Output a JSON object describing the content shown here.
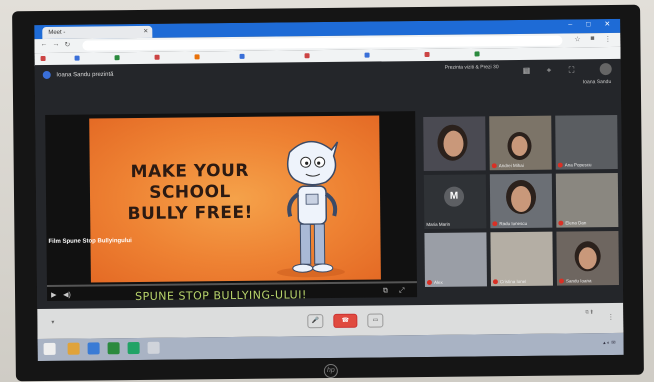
{
  "browser": {
    "tab_title": "Meet - ",
    "window_controls": "– □ ✕",
    "bookmarks": [
      "",
      "",
      "",
      "",
      "",
      "",
      "",
      "",
      "",
      ""
    ]
  },
  "meet": {
    "presenting_text": "Ioana Sandu prezintă",
    "top_info": "Prezinta viziti & Prezi 30",
    "top_right_name": "Ioana Sandu",
    "slide": {
      "line1": "MAKE YOUR",
      "line2": "SCHOOL",
      "line3": "BULLY FREE!"
    },
    "video_label": "Film Spune Stop Bullyingului",
    "subtitle": "SPUNE STOP BULLYING-ULUI!",
    "participants": [
      {
        "name": ""
      },
      {
        "name": "Andrei Mihai"
      },
      {
        "name": "Ana Popescu"
      },
      {
        "name": "Maria Marin",
        "initial": "M"
      },
      {
        "name": "Radu Ionescu"
      },
      {
        "name": "Elena Dan"
      },
      {
        "name": "Alex"
      },
      {
        "name": "Cristina Ionel"
      },
      {
        "name": "Sandu Ioana"
      }
    ]
  },
  "colors": {
    "slide_orange": "#ee8233",
    "subtitle_green": "#b7d36b",
    "accent_blue": "#1e6bd6",
    "mic_red": "#d93025"
  }
}
